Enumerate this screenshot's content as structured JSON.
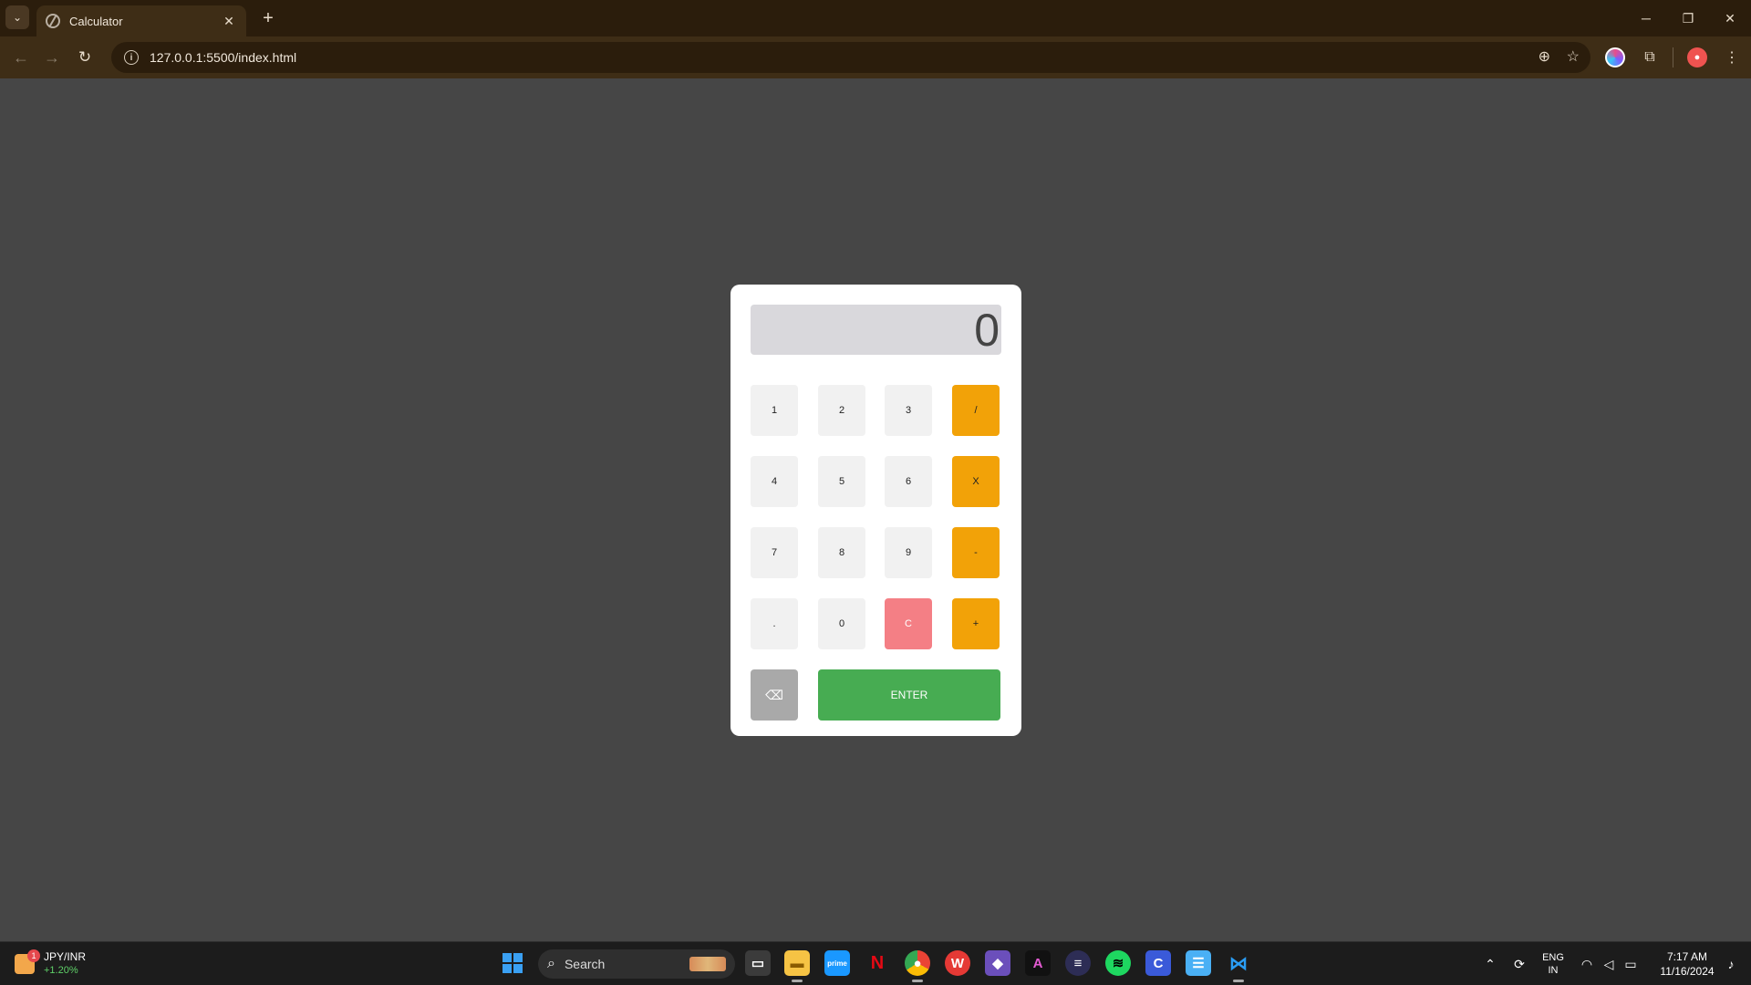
{
  "browser": {
    "tab_title": "Calculator",
    "tab_close": "✕",
    "new_tab": "+",
    "url": "127.0.0.1:5500/index.html",
    "window_controls": {
      "minimize": "─",
      "restore": "❐",
      "close": "✕"
    }
  },
  "calculator": {
    "display_value": "0",
    "keys": {
      "k1": "1",
      "k2": "2",
      "k3": "3",
      "divide": "/",
      "k4": "4",
      "k5": "5",
      "k6": "6",
      "multiply": "X",
      "k7": "7",
      "k8": "8",
      "k9": "9",
      "subtract": "-",
      "decimal": ".",
      "k0": "0",
      "clear": "C",
      "add": "+",
      "backspace": "⌫",
      "enter": "ENTER"
    },
    "colors": {
      "operator": "#f2a208",
      "clear": "#f47f85",
      "enter": "#47ac52",
      "backspace": "#a9a9a9",
      "number": "#f1f1f1",
      "display": "#d9d8dc"
    }
  },
  "taskbar": {
    "widget": {
      "title": "JPY/INR",
      "change": "+1.20%",
      "badge": "1"
    },
    "search_label": "Search",
    "apps": [
      "task-view",
      "file-explorer",
      "prime-video",
      "netflix",
      "chrome",
      "wps-office",
      "obsidian",
      "affinity",
      "notion-calendar",
      "spotify",
      "canva",
      "notepad",
      "vscode"
    ],
    "language": {
      "line1": "ENG",
      "line2": "IN"
    },
    "clock": {
      "time": "7:17 AM",
      "date": "11/16/2024"
    }
  }
}
